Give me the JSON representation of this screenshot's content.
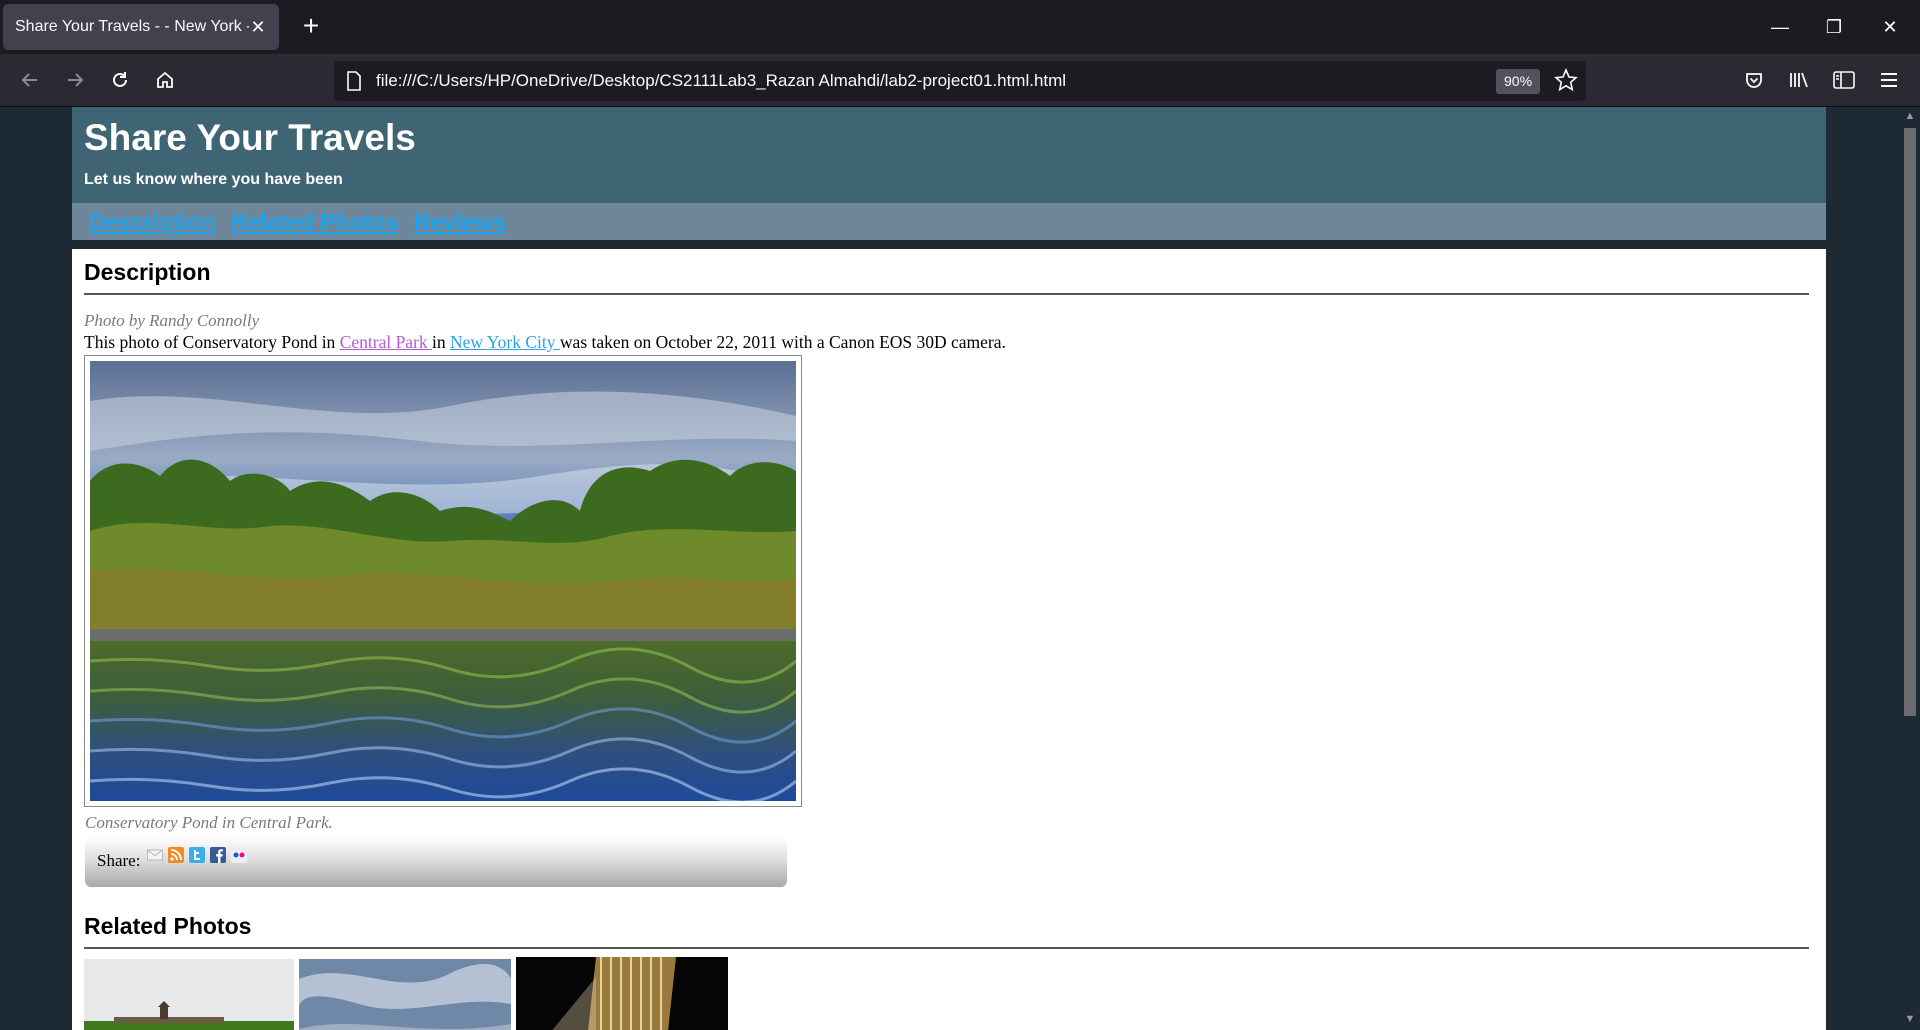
{
  "browser": {
    "tab_title": "Share Your Travels - - New York - C",
    "tab_close": "✕",
    "new_tab": "+",
    "url": "file:///C:/Users/HP/OneDrive/Desktop/CS2111Lab3_Razan Almahdi/lab2-project01.html.html",
    "zoom": "90%",
    "window_controls": {
      "minimize": "—",
      "restore": "❐",
      "close": "✕"
    },
    "icons": [
      "back-icon",
      "forward-icon",
      "reload-icon",
      "home-icon",
      "page-icon",
      "bookmark-star-icon",
      "pocket-icon",
      "library-icon",
      "sidebar-icon",
      "menu-icon"
    ]
  },
  "page": {
    "title": "Share Your Travels",
    "subtitle": "Let us know where you have been",
    "nav": [
      "Description",
      "Related Photos",
      "Reviews"
    ],
    "description_heading": "Description",
    "credit": "Photo by Randy Connolly",
    "desc_before": "This photo of Conservatory Pond in ",
    "link_central_park": "Central Park ",
    "desc_middle": "in ",
    "link_nyc": "New York City ",
    "desc_after": "was taken on October 22, 2011 with a Canon EOS 30D camera.",
    "caption": "Conservatory Pond in Central Park.",
    "share_label": "Share:",
    "share_icons": [
      "email-icon",
      "rss-icon",
      "twitter-icon",
      "facebook-icon",
      "flickr-icon"
    ],
    "related_heading": "Related Photos"
  },
  "colors": {
    "header_bg": "#3f6473",
    "nav_bg": "#6e869a",
    "link": "#1aa3ef",
    "visited_link": "#b25ad4"
  }
}
